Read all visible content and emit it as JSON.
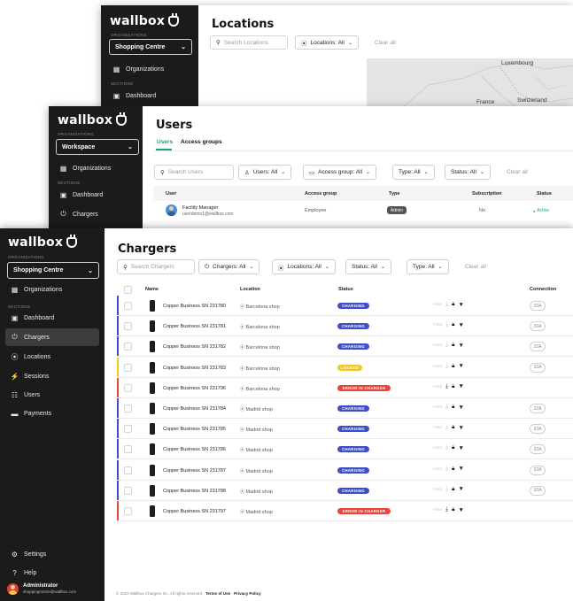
{
  "brand": "wallbox",
  "locations_window": {
    "org_caption": "ORGANIZATIONS",
    "org_selected": "Shopping Centre",
    "nav_organizations": "Organizations",
    "sections_caption": "SECTIONS",
    "nav_dashboard": "Dashboard",
    "title": "Locations",
    "search_placeholder": "Search Locations",
    "filter_locations": "Locations: All",
    "clear_all": "Clear all",
    "map_labels": {
      "luxembourg": "Luxembourg",
      "france": "France",
      "switzerland": "Switzerland"
    }
  },
  "users_window": {
    "org_caption": "ORGANIZATIONS",
    "org_selected": "Workspace",
    "nav_organizations": "Organizations",
    "sections_caption": "SECTIONS",
    "nav_dashboard": "Dashboard",
    "nav_chargers": "Chargers",
    "title": "Users",
    "tabs": [
      "Users",
      "Access groups"
    ],
    "search_placeholder": "Search Users",
    "filters": {
      "users": "Users: All",
      "access_group": "Access group: All",
      "type": "Type: All",
      "status": "Status: All"
    },
    "clear_all": "Clear all",
    "columns": {
      "user": "User",
      "access_group": "Access group",
      "type": "Type",
      "subscription": "Subscription",
      "status": "Status"
    },
    "row": {
      "name": "Facility Manager",
      "email": "userdemo1@wallbox.com",
      "access_group": "Employee",
      "type": "Admin",
      "subscription": "No",
      "status": "Active"
    }
  },
  "chargers_window": {
    "org_caption": "ORGANIZATIONS",
    "org_selected": "Shopping Centre",
    "nav_organizations": "Organizations",
    "sections_caption": "SECTIONS",
    "nav": {
      "dashboard": "Dashboard",
      "chargers": "Chargers",
      "locations": "Locations",
      "sessions": "Sessions",
      "users": "Users",
      "payments": "Payments"
    },
    "bottom": {
      "settings": "Settings",
      "help": "Help",
      "user_name": "Administrator",
      "user_email": "shoppingcentre@wallbox.com"
    },
    "title": "Chargers",
    "search_placeholder": "Search Chargers",
    "filters": {
      "chargers": "Chargers: All",
      "locations": "Locations: All",
      "status": "Status: All",
      "type": "Type: All"
    },
    "clear_all": "Clear all",
    "columns": {
      "name": "Name",
      "location": "Location",
      "status": "Status",
      "connection": "Connection"
    },
    "feature_label": "FREE",
    "colors": {
      "charging": "#3e4fc9",
      "locked": "#f3c623",
      "error": "#e8453c"
    },
    "rows": [
      {
        "name": "Copper Business SN 231780",
        "location": "Barcelona shop",
        "status": "CHARGING",
        "kind": "charging",
        "connection": "32A"
      },
      {
        "name": "Copper Business SN 231781",
        "location": "Barcelona shop",
        "status": "CHARGING",
        "kind": "charging",
        "connection": "32A"
      },
      {
        "name": "Copper Business SN 231782",
        "location": "Barcelona shop",
        "status": "CHARGING",
        "kind": "charging",
        "connection": "32A"
      },
      {
        "name": "Copper Business SN 231783",
        "location": "Barcelona shop",
        "status": "LOCKED",
        "kind": "locked",
        "connection": "32A"
      },
      {
        "name": "Copper Business SN 231796",
        "location": "Barcelona shop",
        "status": "ERROR IN CHARGER",
        "kind": "error",
        "connection": ""
      },
      {
        "name": "Copper Business SN 231784",
        "location": "Madrid shop",
        "status": "CHARGING",
        "kind": "charging",
        "connection": "32A"
      },
      {
        "name": "Copper Business SN 231785",
        "location": "Madrid shop",
        "status": "CHARGING",
        "kind": "charging",
        "connection": "32A"
      },
      {
        "name": "Copper Business SN 231786",
        "location": "Madrid shop",
        "status": "CHARGING",
        "kind": "charging",
        "connection": "32A"
      },
      {
        "name": "Copper Business SN 231787",
        "location": "Madrid shop",
        "status": "CHARGING",
        "kind": "charging",
        "connection": "32A"
      },
      {
        "name": "Copper Business SN 231788",
        "location": "Madrid shop",
        "status": "CHARGING",
        "kind": "charging",
        "connection": "32A"
      },
      {
        "name": "Copper Business SN 231797",
        "location": "Madrid shop",
        "status": "ERROR IN CHARGER",
        "kind": "error",
        "connection": ""
      }
    ],
    "footer": {
      "copyright": "© 2022 Wallbox Chargers Inc. All rights reserved",
      "terms": "Terms of Use",
      "privacy": "Privacy Policy"
    }
  }
}
